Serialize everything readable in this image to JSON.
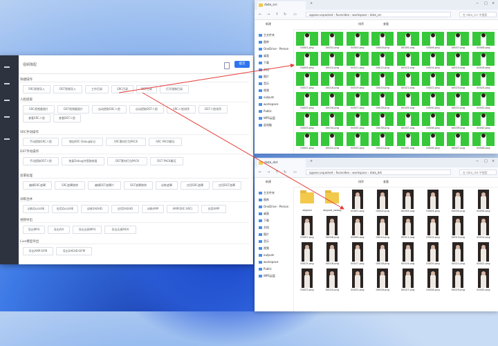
{
  "app": {
    "title": "视频降配",
    "primary_button": "提交",
    "sections": [
      {
        "title": "快捷操作",
        "buttons": [
          "SRC视频导入",
          "DST视频导入",
          "工作目录",
          "SRC目录",
          "DST目录",
          "打开镜像目录"
        ]
      },
      {
        "title": "人脸提取",
        "buttons": [
          "SRC视频截图片",
          "DST视频截图片",
          "自动提取SRC人脸",
          "自动提取DST人脸",
          "SRC人脸排序",
          "DST人脸排序",
          "查看SRC人脸",
          "查看DST人脸"
        ]
      },
      {
        "title": "SRC手动操作",
        "buttons": [
          "手动提取SRC人脸",
          "增加SRC Debug标记",
          "SRC素材打包PACK",
          "SRC PACK解压"
        ]
      },
      {
        "title": "DST手动操作",
        "buttons": [
          "手动提取DST人脸",
          "恢复Debug并提取修复",
          "DST素材打包PACK",
          "DST PACK解压"
        ]
      },
      {
        "title": "遮罩处理",
        "buttons": [
          "编辑SRC遮罩",
          "SRC遮罩移除",
          "编辑DST遮罩片",
          "DST遮罩移除",
          "训练遮罩",
          "应用SRC遮罩",
          "应用DST遮罩"
        ]
      },
      {
        "title": "训练合并",
        "buttons": [
          "训练Quick96",
          "应用Quick96",
          "训练SAEHD",
          "应用SAEHD",
          "训练AMP",
          "AMP(SRC-SRC)",
          "应用AMP"
        ]
      },
      {
        "title": "视频导出",
        "buttons": [
          "导出MP4",
          "导出AVI",
          "导出无损MP4",
          "导出无损MOV"
        ]
      },
      {
        "title": "Live模型导出",
        "buttons": [
          "导出AMP-DFM",
          "导出SAEHD-DFM"
        ]
      }
    ]
  },
  "explorer_top": {
    "tab": "data_src",
    "path": [
      "appear.unpacked",
      "facevideo",
      "workspace",
      "data_src"
    ],
    "search_placeholder": "在 data_src 中搜索",
    "toolbar": [
      "新建",
      "排序",
      "查看"
    ],
    "nav": [
      "主文件夹",
      "图库",
      "OneDrive - Person",
      "桌面",
      "下载",
      "文档",
      "图片",
      "音乐",
      "视频",
      "outputs",
      "workspace",
      "Public",
      "WPS云盘",
      "此电脑"
    ],
    "files": [
      "00001.png",
      "00002.png",
      "00003.png",
      "00004.png",
      "00005.png",
      "00006.png",
      "00007.png",
      "00008.png",
      "00009.png",
      "00010.png",
      "00011.png",
      "00012.png",
      "00013.png",
      "00014.png",
      "00015.png",
      "00016.png",
      "00017.png",
      "00018.png",
      "00019.png",
      "00020.png",
      "00021.png",
      "00022.png",
      "00023.png",
      "00024.png",
      "00025.png",
      "00026.png",
      "00027.png",
      "00028.png",
      "00029.png",
      "00030.png",
      "00031.png",
      "00032.png",
      "00033.png",
      "00034.png",
      "00035.png",
      "00036.png",
      "00037.png",
      "00038.png",
      "00039.png",
      "00040.png",
      "00041.png",
      "00042.png",
      "00043.png",
      "00044.png",
      "00045.png",
      "00046.png",
      "00047.png",
      "00048.png"
    ]
  },
  "explorer_bottom": {
    "tab": "data_dst",
    "path": [
      "appear.unpacked",
      "facevideo",
      "workspace",
      "data_dst"
    ],
    "search_placeholder": "在 data_dst 中搜索",
    "toolbar": [
      "新建",
      "排序",
      "查看"
    ],
    "nav": [
      "主文件夹",
      "图库",
      "OneDrive - Person",
      "桌面",
      "下载",
      "文档",
      "图片",
      "音乐",
      "视频",
      "outputs",
      "workspace",
      "Public",
      "WPS云盘"
    ],
    "folders": [
      "aligned",
      "aligned_debug"
    ],
    "files": [
      "00001.png",
      "00002.png",
      "00003.png",
      "00004.png",
      "00005.png",
      "00006.png",
      "00007.png",
      "00008.png",
      "00009.png",
      "00010.png",
      "00011.png",
      "00012.png",
      "00013.png",
      "00014.png",
      "00015.png",
      "00016.png",
      "00017.png",
      "00018.png",
      "00019.png",
      "00020.png",
      "00021.png",
      "00022.png",
      "00023.png",
      "00024.png",
      "00025.png",
      "00026.png",
      "00027.png",
      "00028.png",
      "00029.png",
      "00030.png"
    ]
  },
  "colors": {
    "accent": "#2f74ee",
    "green_screen": "#36c83a",
    "arrow": "#e53935"
  }
}
